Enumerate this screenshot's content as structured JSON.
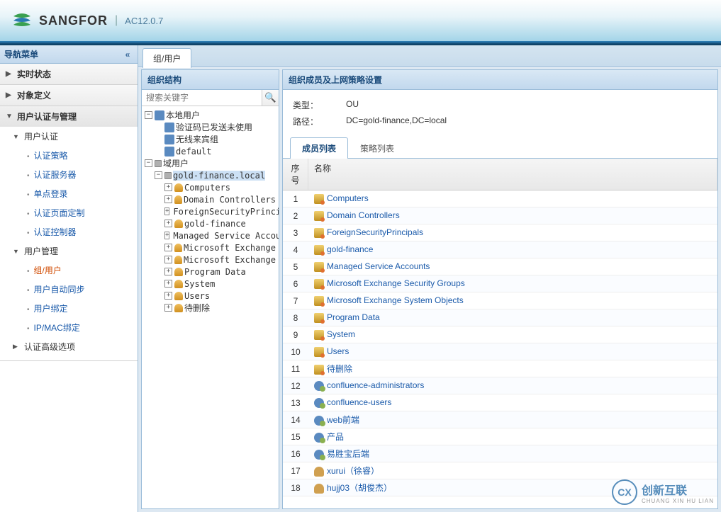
{
  "header": {
    "brand": "SANGFOR",
    "version": "AC12.0.7"
  },
  "nav": {
    "title": "导航菜单",
    "groups": [
      {
        "label": "实时状态",
        "expanded": false
      },
      {
        "label": "对象定义",
        "expanded": false
      },
      {
        "label": "用户认证与管理",
        "expanded": true,
        "sections": [
          {
            "label": "用户认证",
            "items": [
              "认证策略",
              "认证服务器",
              "单点登录",
              "认证页面定制",
              "认证控制器"
            ]
          },
          {
            "label": "用户管理",
            "items": [
              "组/用户",
              "用户自动同步",
              "用户绑定",
              "IP/MAC绑定"
            ],
            "selected": 0
          }
        ]
      },
      {
        "label": "认证高级选项",
        "naked": true
      }
    ]
  },
  "top_tab": "组/用户",
  "org": {
    "title": "组织结构",
    "search_placeholder": "搜索关键字",
    "tree": {
      "local_root": "本地用户",
      "local_children": [
        "验证码已发送未使用",
        "无线来宾组",
        "default"
      ],
      "domain_root": "域用户",
      "domain": "gold-finance.local",
      "domain_children": [
        "Computers",
        "Domain Controllers",
        "ForeignSecurityPrincipals",
        "gold-finance",
        "Managed Service Accounts",
        "Microsoft Exchange",
        "Microsoft Exchange",
        "Program Data",
        "System",
        "Users",
        "待删除"
      ]
    }
  },
  "detail": {
    "title": "组织成员及上网策略设置",
    "type_label": "类型：",
    "type_value": "OU",
    "path_label": "路径：",
    "path_value": "DC=gold-finance,DC=local",
    "tabs": [
      "成员列表",
      "策略列表"
    ],
    "cols": {
      "idx": "序号",
      "name": "名称"
    },
    "rows": [
      {
        "n": 1,
        "icon": "ou",
        "name": "Computers"
      },
      {
        "n": 2,
        "icon": "ou",
        "name": "Domain Controllers"
      },
      {
        "n": 3,
        "icon": "ou",
        "name": "ForeignSecurityPrincipals"
      },
      {
        "n": 4,
        "icon": "ou",
        "name": "gold-finance"
      },
      {
        "n": 5,
        "icon": "ou",
        "name": "Managed Service Accounts"
      },
      {
        "n": 6,
        "icon": "ou",
        "name": "Microsoft Exchange Security Groups"
      },
      {
        "n": 7,
        "icon": "ou",
        "name": "Microsoft Exchange System Objects"
      },
      {
        "n": 8,
        "icon": "ou",
        "name": "Program Data"
      },
      {
        "n": 9,
        "icon": "ou",
        "name": "System"
      },
      {
        "n": 10,
        "icon": "ou",
        "name": "Users"
      },
      {
        "n": 11,
        "icon": "ou",
        "name": "待删除"
      },
      {
        "n": 12,
        "icon": "grp",
        "name": "confluence-administrators"
      },
      {
        "n": 13,
        "icon": "grp",
        "name": "confluence-users"
      },
      {
        "n": 14,
        "icon": "grp",
        "name": "web前端"
      },
      {
        "n": 15,
        "icon": "grp",
        "name": "产品"
      },
      {
        "n": 16,
        "icon": "grp",
        "name": "易胜宝后端"
      },
      {
        "n": 17,
        "icon": "usr",
        "name": "xurui（徐睿）"
      },
      {
        "n": 18,
        "icon": "usr",
        "name": "hujj03（胡俊杰）"
      }
    ]
  },
  "watermark": {
    "main": "创新互联",
    "sub": "CHUANG XIN HU LIAN",
    "logo": "CX"
  }
}
